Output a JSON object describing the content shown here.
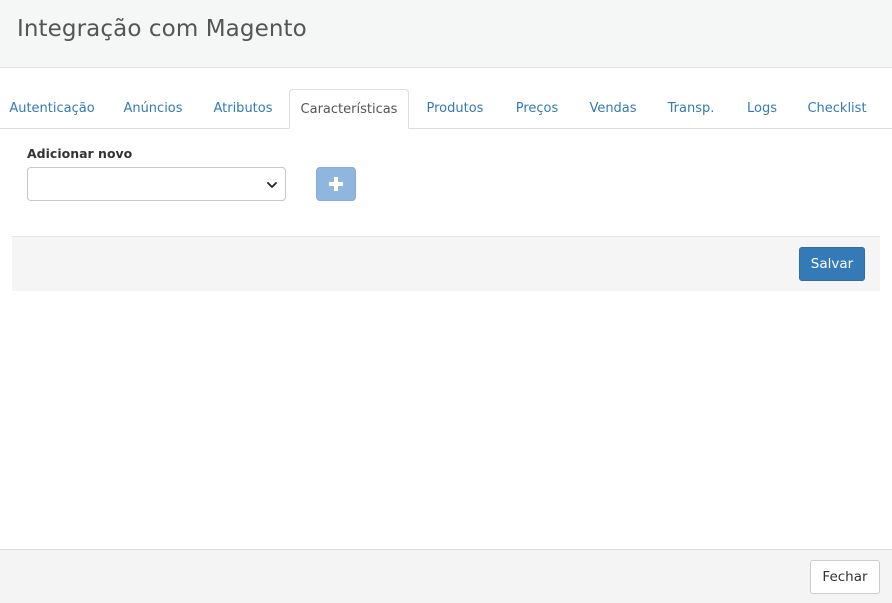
{
  "window": {
    "title": "Integração com Magento"
  },
  "tabs": [
    {
      "label": "Autenticação",
      "active": false
    },
    {
      "label": "Anúncios",
      "active": false
    },
    {
      "label": "Atributos",
      "active": false
    },
    {
      "label": "Características",
      "active": true
    },
    {
      "label": "Produtos",
      "active": false
    },
    {
      "label": "Preços",
      "active": false
    },
    {
      "label": "Vendas",
      "active": false
    },
    {
      "label": "Transp.",
      "active": false
    },
    {
      "label": "Logs",
      "active": false
    },
    {
      "label": "Checklist",
      "active": false
    }
  ],
  "form": {
    "add_new_label": "Adicionar novo",
    "select_value": "",
    "add_button_icon": "plus-icon"
  },
  "actions": {
    "save_label": "Salvar",
    "close_label": "Fechar"
  },
  "colors": {
    "link": "#337ab7",
    "primary": "#337ab7",
    "add_button": "#8fb6de"
  }
}
